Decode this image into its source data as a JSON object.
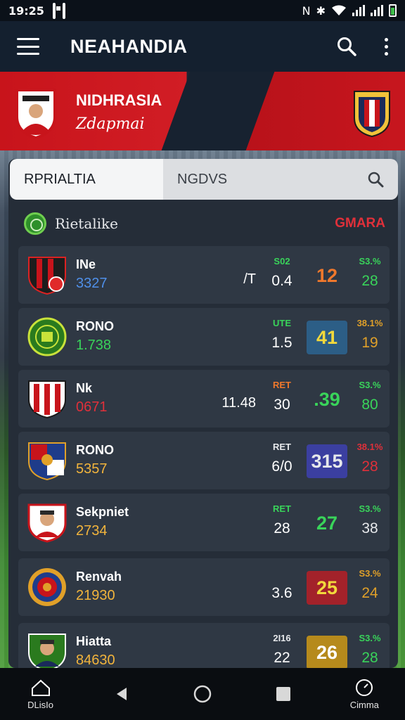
{
  "status_bar": {
    "time": "19:25",
    "icons": [
      "gallery-icon",
      "image-icon",
      "nfc-icon",
      "bluetooth-icon",
      "wifi-icon",
      "signal-icon",
      "signal-icon",
      "battery-icon"
    ]
  },
  "app_bar": {
    "title": "NEAHANDIA",
    "menu_icon": "hamburger-icon",
    "search_icon": "search-icon",
    "more_icon": "more-vert-icon"
  },
  "hero": {
    "name": "NIDHRASIA",
    "subtitle": "Zdapmai"
  },
  "tabs": [
    {
      "label": "RPRIALTIA",
      "active": true
    },
    {
      "label": "NGDVS",
      "active": false
    }
  ],
  "section": {
    "title": "Rietalike",
    "action": "GMARA"
  },
  "rows": [
    {
      "name": "INe",
      "code": "3327",
      "mid": "/T",
      "c1_top": "S02",
      "c1_bot": "0.4",
      "score": "12",
      "c3_top": "S3.%",
      "c3_bot": "28",
      "colors": {
        "code": "#4f8fe8",
        "c1_top": "#39d45a",
        "score_bg": "transparent",
        "score_fg": "#f0782c",
        "c3_top": "#39d45a",
        "c3_bot": "#39d45a"
      }
    },
    {
      "name": "RONO",
      "code": "1.738",
      "mid": "",
      "c1_top": "UTE",
      "c1_bot": "1.5",
      "score": "41",
      "c3_top": "38.1%",
      "c3_bot": "19",
      "colors": {
        "code": "#39d45a",
        "c1_top": "#39d45a",
        "score_bg": "#2c5e86",
        "score_fg": "#f2d93c",
        "c3_top": "#e0a029",
        "c3_bot": "#e0a029"
      }
    },
    {
      "name": "Nk",
      "code": "0671",
      "mid": "11.48",
      "c1_top": "RET",
      "c1_bot": "30",
      "score": ".39",
      "c3_top": "S3.%",
      "c3_bot": "80",
      "colors": {
        "code": "#e0303a",
        "c1_top": "#f0782c",
        "score_bg": "transparent",
        "score_fg": "#39d45a",
        "c3_top": "#39d45a",
        "c3_bot": "#39d45a"
      }
    },
    {
      "name": "RONO",
      "code": "5357",
      "mid": "",
      "c1_top": "RET",
      "c1_bot": "6/0",
      "score": "315",
      "c3_top": "38.1%",
      "c3_bot": "28",
      "colors": {
        "code": "#f2b43c",
        "c1_top": "#e6e8eb",
        "score_bg": "#3b3fa0",
        "score_fg": "#e6e8eb",
        "c3_top": "#e0303a",
        "c3_bot": "#e0303a"
      }
    },
    {
      "name": "Sekpniet",
      "code": "2734",
      "mid": "",
      "c1_top": "RET",
      "c1_bot": "28",
      "score": "27",
      "c3_top": "S3.%",
      "c3_bot": "38",
      "colors": {
        "code": "#f2b43c",
        "c1_top": "#39d45a",
        "score_bg": "transparent",
        "score_fg": "#39d45a",
        "c3_top": "#39d45a",
        "c3_bot": "#e6e8eb"
      }
    },
    {
      "name": "Renvah",
      "code": "21930",
      "mid": "",
      "c1_top": "",
      "c1_bot": "3.6",
      "score": "25",
      "c3_top": "S3.%",
      "c3_bot": "24",
      "colors": {
        "code": "#f2b43c",
        "c1_top": "#e6e8eb",
        "score_bg": "#a3222a",
        "score_fg": "#f2d93c",
        "c3_top": "#e0a029",
        "c3_bot": "#e0a029"
      }
    },
    {
      "name": "Hiatta",
      "code": "84630",
      "mid": "",
      "c1_top": "2I16",
      "c1_bot": "22",
      "score": "26",
      "c3_top": "S3.%",
      "c3_bot": "28",
      "colors": {
        "code": "#f2b43c",
        "c1_top": "#e6e8eb",
        "score_bg": "#b68a1c",
        "score_fg": "#ffffff",
        "c3_top": "#39d45a",
        "c3_bot": "#39d45a"
      }
    }
  ],
  "nav_bar": {
    "left_label": "DLisIo",
    "right_label": "Cimma",
    "icons": [
      "home-icon",
      "back-icon",
      "home-circle-icon",
      "recents-icon",
      "clock-icon"
    ]
  }
}
